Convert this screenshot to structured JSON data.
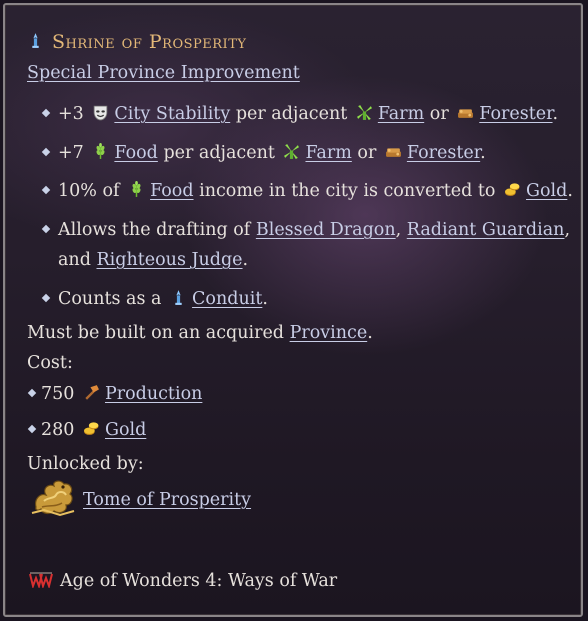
{
  "title": "Shrine of Prosperity",
  "subtitle": "Special Province Improvement",
  "effects": {
    "e1": {
      "pre": "+3",
      "stat": "City Stability",
      "mid": "per adjacent",
      "farm": "Farm",
      "or": "or",
      "forester": "Forester",
      "end": "."
    },
    "e2": {
      "pre": "+7",
      "stat": "Food",
      "mid": "per adjacent",
      "farm": "Farm",
      "or": "or",
      "forester": "Forester",
      "end": "."
    },
    "e3": {
      "pre": "10% of",
      "stat": "Food",
      "mid": "income in the city is converted to",
      "gold": "Gold",
      "end": "."
    },
    "e4": {
      "pre": "Allows the drafting of",
      "unit1": "Blessed Dragon",
      "sep1": ",",
      "unit2": "Radiant Guardian",
      "sep2": ",",
      "and": "and",
      "unit3": "Righteous Judge",
      "end": "."
    },
    "e5": {
      "pre": "Counts as a",
      "conduit": "Conduit",
      "end": "."
    }
  },
  "requirement": {
    "pre": "Must be built on an acquired",
    "province": "Province",
    "end": "."
  },
  "cost": {
    "label": "Cost:",
    "production": {
      "amount": "750",
      "label": "Production"
    },
    "gold": {
      "amount": "280",
      "label": "Gold"
    }
  },
  "unlock": {
    "label": "Unlocked by:",
    "tome": "Tome of Prosperity"
  },
  "footer": {
    "game": "Age of Wonders 4: Ways of War"
  },
  "icons": {
    "title": "conduit-icon",
    "stability": "stability-mask-icon",
    "farm": "windmill-icon",
    "forester": "forester-icon",
    "food": "wheat-icon",
    "gold": "gold-coins-icon",
    "production": "hammer-icon",
    "tome": "dragon-tome-icon",
    "logo": "ways-of-war-logo-icon"
  },
  "colors": {
    "title": "#e3b878",
    "link": "#c8cde6",
    "text": "#e6e1dc",
    "border": "#8a8588"
  }
}
